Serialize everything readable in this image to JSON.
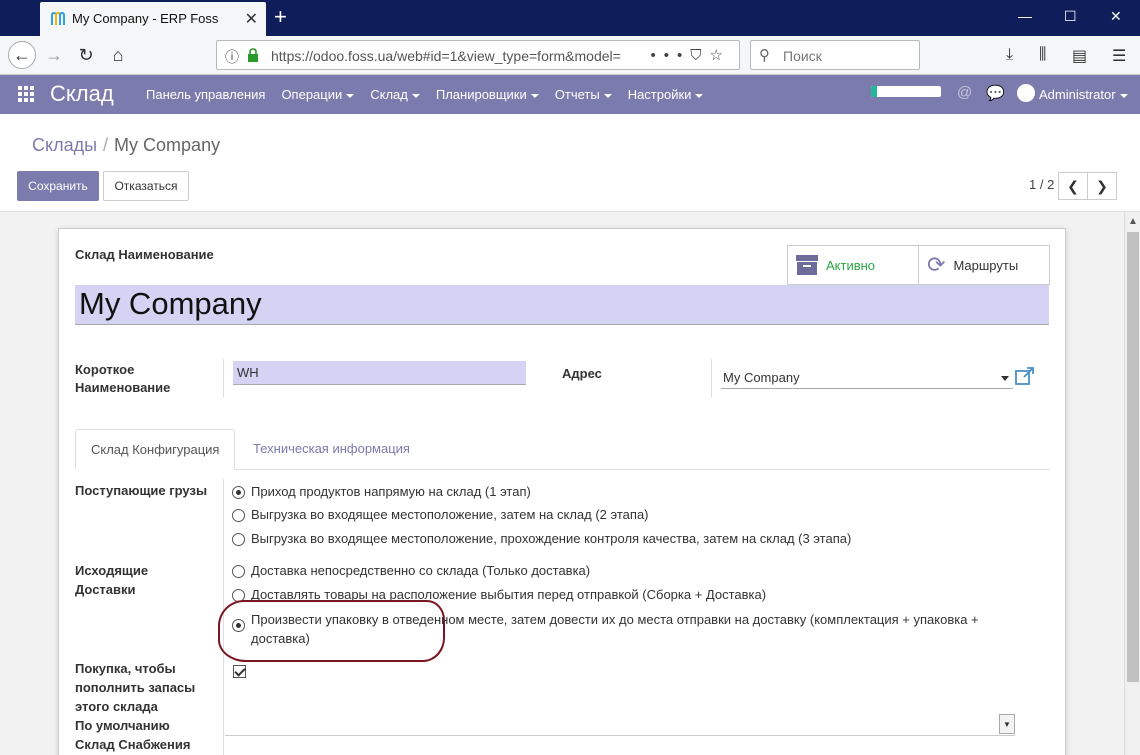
{
  "browser": {
    "tab_title": "My Company - ERP Foss",
    "url": "https://odoo.foss.ua/web#id=1&view_type=form&model=",
    "search_placeholder": "Поиск"
  },
  "menu": {
    "brand": "Склад",
    "items": [
      "Панель управления",
      "Операции",
      "Склад",
      "Планировщики",
      "Отчеты",
      "Настройки"
    ],
    "user": "Administrator",
    "progress_fraction": 0.08
  },
  "breadcrumb": {
    "parent": "Склады",
    "separator": "/",
    "current": "My Company"
  },
  "buttons": {
    "save": "Сохранить",
    "discard": "Отказаться"
  },
  "pager": {
    "value": "1 / 2"
  },
  "form": {
    "name_label": "Склад Наименование",
    "name_value": "My Company",
    "smart_buttons": {
      "active": "Активно",
      "routes": "Маршруты"
    },
    "short_name_label_1": "Короткое",
    "short_name_label_2": "Наименование",
    "short_name_value": "WH",
    "address_label": "Адрес",
    "address_value": "My Company",
    "tabs": [
      "Склад Конфигурация",
      "Техническая информация"
    ],
    "incoming_label": "Поступающие грузы",
    "incoming_options": [
      "Приход продуктов напрямую на склад (1 этап)",
      "Выгрузка во входящее местоположение, затем на склад (2 этапа)",
      "Выгрузка во входящее местоположение, прохождение контроля качества, затем на склад (3 этапа)"
    ],
    "outgoing_label_1": "Исходящие",
    "outgoing_label_2": "Доставки",
    "outgoing_options": [
      "Доставка непосредственно со склада (Только доставка)",
      "Доставлять товары на расположение выбытия перед отправкой (Сборка + Доставка)",
      "Произвести упаковку в отведенном месте, затем довести их до места отправки на доставку (комплектация + упаковка +",
      "доставка)"
    ],
    "buy_label_1": "Покупка, чтобы",
    "buy_label_2": "пополнить запасы",
    "buy_label_3": "этого склада",
    "default_label_1": "По умолчанию",
    "default_label_2": "Склад Снабжения"
  }
}
